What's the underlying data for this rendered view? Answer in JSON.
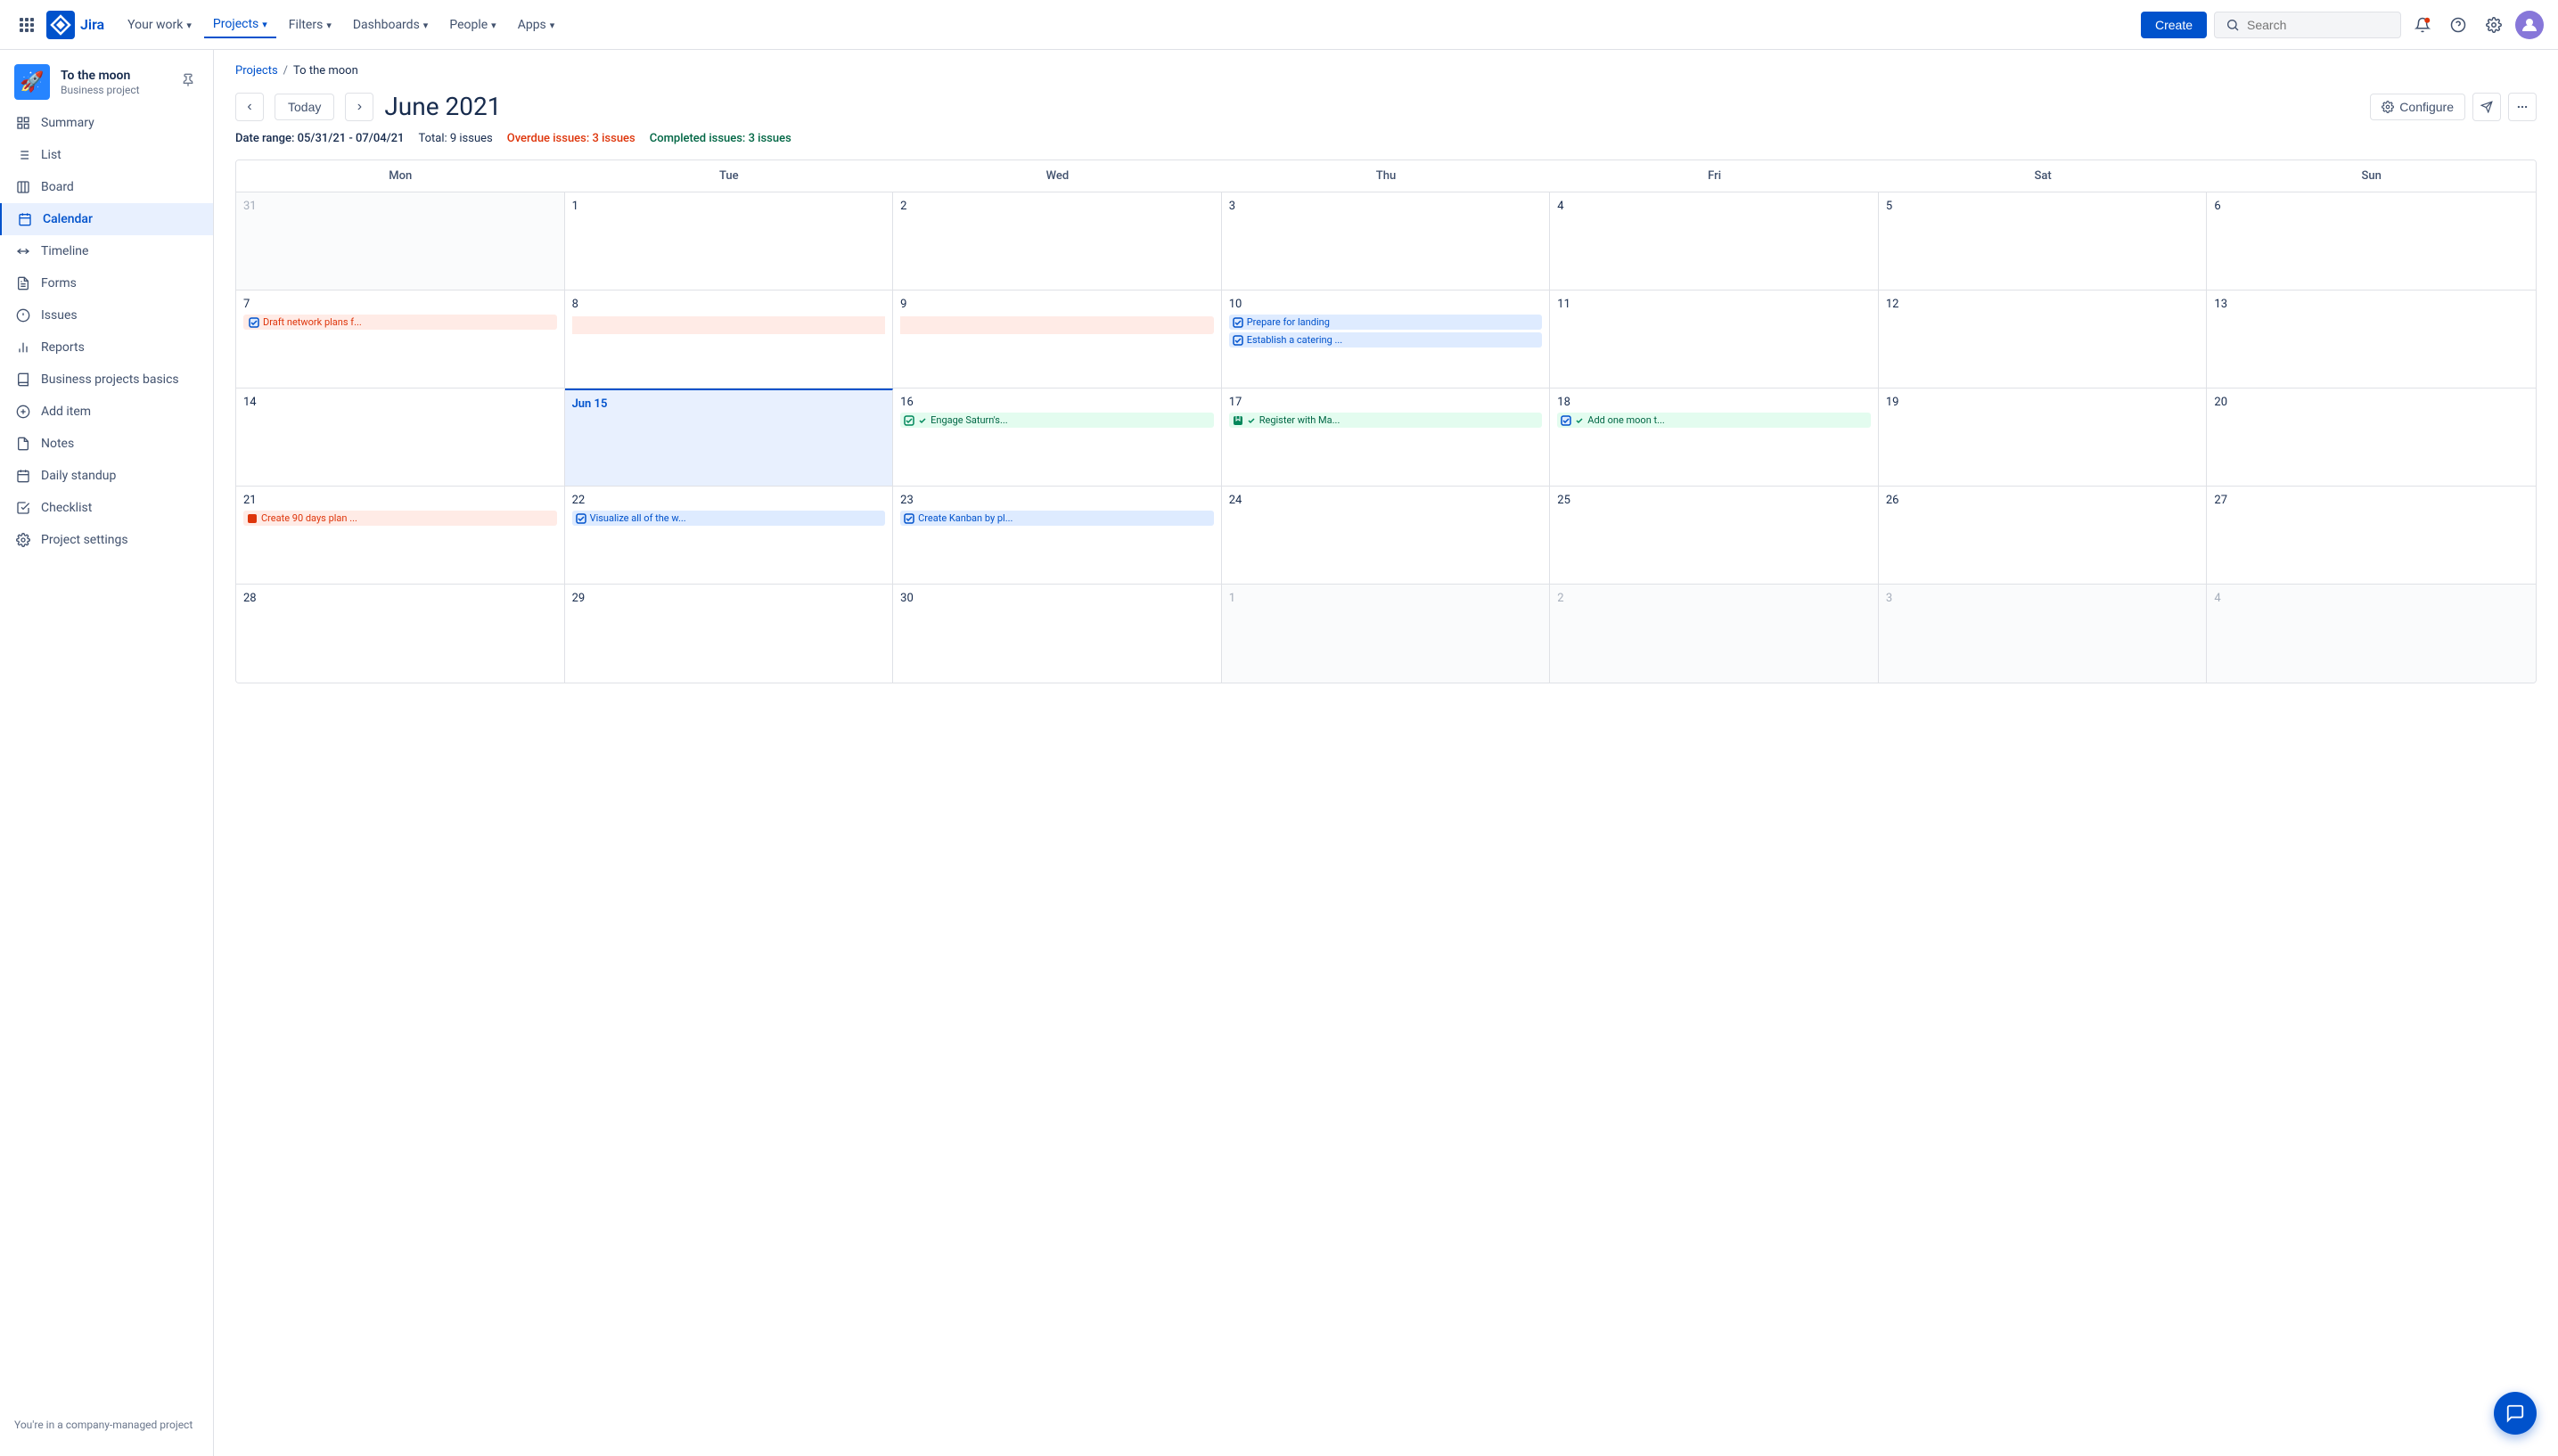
{
  "topnav": {
    "logo_text": "Jira",
    "nav_items": [
      {
        "label": "Your work",
        "has_dropdown": true
      },
      {
        "label": "Projects",
        "has_dropdown": true,
        "active": true
      },
      {
        "label": "Filters",
        "has_dropdown": true
      },
      {
        "label": "Dashboards",
        "has_dropdown": true
      },
      {
        "label": "People",
        "has_dropdown": true
      },
      {
        "label": "Apps",
        "has_dropdown": true
      }
    ],
    "create_label": "Create",
    "search_placeholder": "Search"
  },
  "sidebar": {
    "project_name": "To the moon",
    "project_type": "Business project",
    "nav_items": [
      {
        "label": "Summary",
        "icon": "≡"
      },
      {
        "label": "List",
        "icon": "☰"
      },
      {
        "label": "Board",
        "icon": "⊞"
      },
      {
        "label": "Calendar",
        "icon": "📅",
        "active": true
      },
      {
        "label": "Timeline",
        "icon": "⊟"
      },
      {
        "label": "Forms",
        "icon": "⊡"
      },
      {
        "label": "Issues",
        "icon": "⚠"
      },
      {
        "label": "Reports",
        "icon": "📊"
      },
      {
        "label": "Business projects basics",
        "icon": "📚"
      },
      {
        "label": "Add item",
        "icon": "⊕"
      },
      {
        "label": "Notes",
        "icon": "📝"
      },
      {
        "label": "Daily standup",
        "icon": "🗓"
      },
      {
        "label": "Checklist",
        "icon": "✅"
      },
      {
        "label": "Project settings",
        "icon": "⚙"
      }
    ],
    "footer_text": "You're in a company-managed project"
  },
  "breadcrumb": {
    "projects_label": "Projects",
    "separator": "/",
    "current": "To the moon"
  },
  "calendar": {
    "prev_label": "‹",
    "next_label": "›",
    "today_label": "Today",
    "title": "June 2021",
    "configure_label": "Configure",
    "date_range": "Date range: 05/31/21 - 07/04/21",
    "total_issues": "Total: 9 issues",
    "overdue_label": "Overdue issues:",
    "overdue_count": "3 issues",
    "completed_label": "Completed issues:",
    "completed_count": "3 issues",
    "days": [
      "Mon",
      "Tue",
      "Wed",
      "Thu",
      "Fri",
      "Sat",
      "Sun"
    ],
    "weeks": [
      [
        {
          "date": "31",
          "other_month": true,
          "events": []
        },
        {
          "date": "1",
          "events": []
        },
        {
          "date": "2",
          "events": []
        },
        {
          "date": "3",
          "events": []
        },
        {
          "date": "4",
          "events": []
        },
        {
          "date": "5",
          "events": []
        },
        {
          "date": "6",
          "events": []
        }
      ],
      [
        {
          "date": "7",
          "events": [
            {
              "type": "span-start",
              "text": "Draft network plans f...",
              "color": "blue-span",
              "icon": "checkbox"
            }
          ]
        },
        {
          "date": "8",
          "events": [
            {
              "type": "span-middle",
              "text": "",
              "color": "blue-span"
            }
          ]
        },
        {
          "date": "9",
          "events": [
            {
              "type": "span-end",
              "text": "",
              "color": "blue-span"
            }
          ]
        },
        {
          "date": "10",
          "events": [
            {
              "text": "Prepare for landing",
              "color": "blue",
              "icon": "checkbox"
            },
            {
              "text": "Establish a catering ...",
              "color": "blue",
              "icon": "checkbox"
            }
          ]
        },
        {
          "date": "11",
          "events": []
        },
        {
          "date": "12",
          "events": []
        },
        {
          "date": "13",
          "events": []
        }
      ],
      [
        {
          "date": "14",
          "events": []
        },
        {
          "date": "Jun 15",
          "today": true,
          "events": []
        },
        {
          "date": "16",
          "events": [
            {
              "text": "Engage Saturn's...",
              "color": "green",
              "icon": "checkbox-check",
              "check_color": "green"
            }
          ]
        },
        {
          "date": "17",
          "events": [
            {
              "text": "Register with Ma...",
              "color": "green",
              "icon": "bookmark",
              "check_color": "green"
            }
          ]
        },
        {
          "date": "18",
          "events": [
            {
              "text": "Add one moon t...",
              "color": "green",
              "icon": "checkbox-check",
              "check_color": "green"
            }
          ]
        },
        {
          "date": "19",
          "events": []
        },
        {
          "date": "20",
          "events": []
        }
      ],
      [
        {
          "date": "21",
          "events": [
            {
              "text": "Create 90 days plan ...",
              "color": "red",
              "icon": "stop"
            }
          ]
        },
        {
          "date": "22",
          "events": [
            {
              "text": "Visualize all of the w...",
              "color": "blue",
              "icon": "checkbox"
            }
          ]
        },
        {
          "date": "23",
          "events": [
            {
              "text": "Create Kanban by pl...",
              "color": "blue",
              "icon": "checkbox"
            }
          ]
        },
        {
          "date": "24",
          "events": []
        },
        {
          "date": "25",
          "events": []
        },
        {
          "date": "26",
          "events": []
        },
        {
          "date": "27",
          "events": []
        }
      ],
      [
        {
          "date": "28",
          "events": []
        },
        {
          "date": "29",
          "events": []
        },
        {
          "date": "30",
          "events": []
        },
        {
          "date": "1",
          "other_month": true,
          "events": []
        },
        {
          "date": "2",
          "other_month": true,
          "events": []
        },
        {
          "date": "3",
          "other_month": true,
          "events": []
        },
        {
          "date": "4",
          "other_month": true,
          "events": []
        }
      ]
    ]
  }
}
